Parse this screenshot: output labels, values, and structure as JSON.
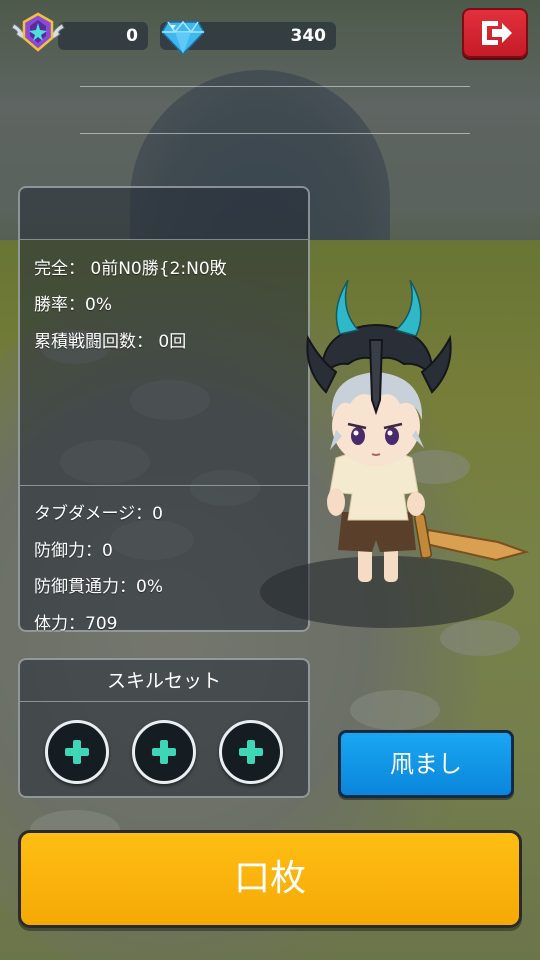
{
  "header": {
    "trophy_count": "0",
    "gem_count": "340"
  },
  "stats": {
    "record": "完全： 0前N0勝{2:N0敗",
    "win_rate": "勝率：0%",
    "total_battles": "累積戦闘回数： 0回",
    "tap_damage": "タブダメージ：0",
    "defense": "防御力：0",
    "defense_penetration": "防御貫通力：0%",
    "hp": "体力：709"
  },
  "skill_set": {
    "title": "スキルセット"
  },
  "buttons": {
    "blue_label": "凧まし",
    "orange_label": "口枚"
  },
  "colors": {
    "exit_red": "#d8242f",
    "blue_button": "#0f96e8",
    "orange_button": "#f7b10a",
    "plus_cyan": "#3fd6b8"
  },
  "icons": {
    "badge": "winged-rank-badge-icon",
    "gem": "diamond-icon",
    "exit": "exit-icon",
    "skill_slot": "plus-icon"
  }
}
